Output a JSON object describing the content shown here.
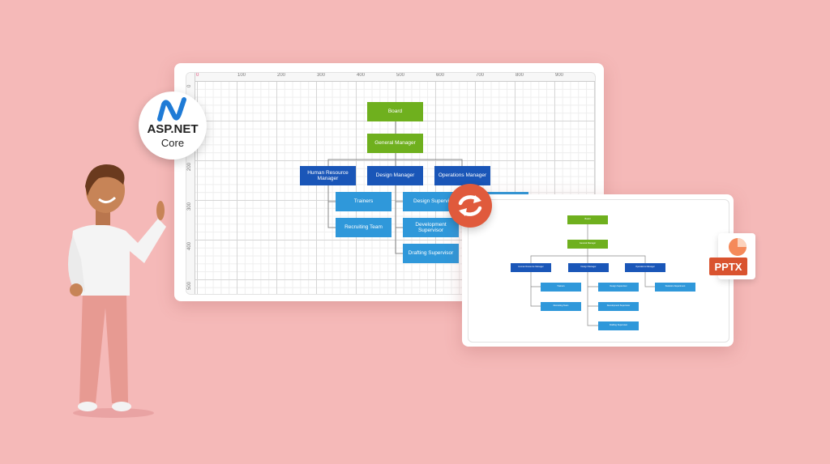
{
  "colors": {
    "background": "#f5b9b8",
    "level1": "#6fb01e",
    "level2": "#1a56b8",
    "level3": "#2f98da",
    "sync": "#e05a3c",
    "pptx": "#d9532f"
  },
  "badges": {
    "aspnet_line1": "ASP.NET",
    "aspnet_line2": "Core",
    "sync_icon": "sync-icon",
    "pptx_label": "PPTX"
  },
  "ruler": {
    "top": [
      "0",
      "100",
      "200",
      "300",
      "400",
      "500",
      "600",
      "700",
      "800",
      "900"
    ],
    "left": [
      "0",
      "200",
      "300",
      "400",
      "500"
    ]
  },
  "orgchart": {
    "board": "Board",
    "general_manager": "General Manager",
    "hr_manager": "Human Resource Manager",
    "design_manager": "Design Manager",
    "operations_manager": "Operations Manager",
    "trainers": "Trainers",
    "recruiting_team": "Recruiting Team",
    "design_supervisor": "Design Supervisor",
    "development_supervisor": "Development Supervisor",
    "drafting_supervisor": "Drafting Supervisor",
    "statistics_department": "Statistics Department"
  }
}
